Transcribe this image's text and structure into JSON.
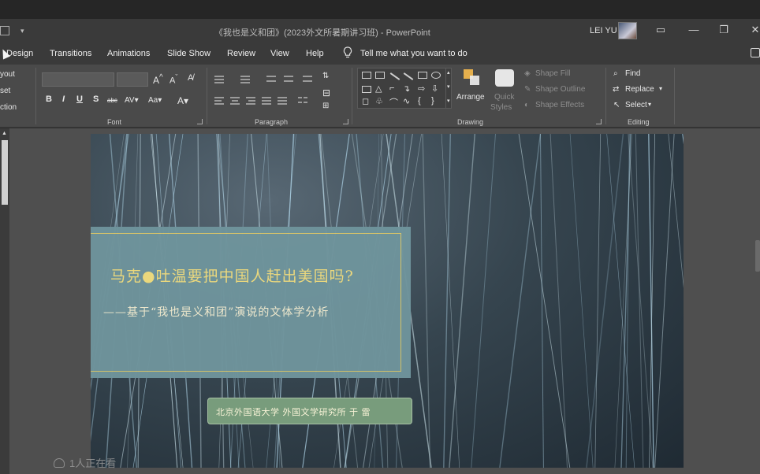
{
  "window": {
    "title": "《我也是义和团》(2023外文所暑期讲习班) - PowerPoint",
    "user": "LEI YU"
  },
  "menu": {
    "items": [
      "Design",
      "Transitions",
      "Animations",
      "Slide Show",
      "Review",
      "View",
      "Help"
    ],
    "tell_me": "Tell me what you want to do"
  },
  "ribbon": {
    "slides_group": [
      "yout",
      "set",
      "ction"
    ],
    "font_group_label": "Font",
    "paragraph_group_label": "Paragraph",
    "drawing_group_label": "Drawing",
    "editing_group_label": "Editing",
    "arrange_label": "Arrange",
    "quick_styles_label": [
      "Quick",
      "Styles"
    ],
    "shape_fill": "Shape Fill",
    "shape_outline": "Shape Outline",
    "shape_effects": "Shape Effects",
    "find": "Find",
    "replace": "Replace",
    "select": "Select"
  },
  "slide": {
    "title": "马克●吐温要把中国人赶出美国吗?",
    "subtitle": "——基于“我也是义和团”演说的文体学分析",
    "author": "北京外国语大学  外国文学研究所  于 雷"
  },
  "overlay": {
    "viewers": "1人正在看"
  },
  "icons": [
    "lightbulb-icon",
    "find-icon",
    "replace-icon",
    "select-icon",
    "share-icon",
    "viewers-icon"
  ]
}
